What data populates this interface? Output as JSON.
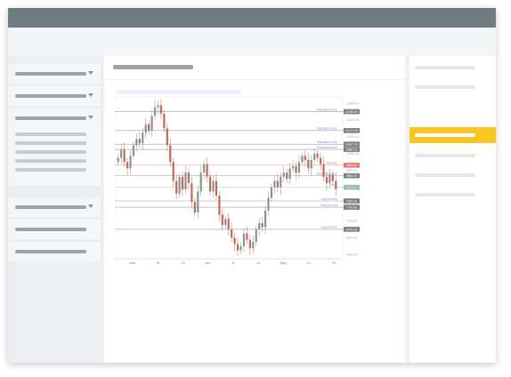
{
  "app": {
    "accent_color": "#f7c620",
    "titlebar_color": "#6e7c82"
  },
  "chart_data": {
    "type": "candlestick",
    "x_ticks": [
      "Mar",
      "15",
      "22",
      "Apr",
      "5",
      "12",
      "May",
      "10",
      "22"
    ],
    "y_ticks": [
      "13000.00",
      "12200.00",
      "11400.00",
      "10600.00",
      "9800.00",
      "9000.00",
      "8200.00",
      "7400.00",
      "6600.00",
      "5800.00"
    ],
    "series": [
      {
        "values": [
          10400,
          10800,
          10200,
          9900,
          10500,
          11000,
          11300,
          11100,
          11600,
          12000,
          11700,
          12400,
          12800,
          12900,
          12500,
          11800,
          11000,
          10200,
          9300,
          8700,
          9500,
          8900,
          9700,
          9200,
          8300,
          7800,
          8800,
          9700,
          10100,
          9500,
          8800,
          9300,
          8600,
          7700,
          7200,
          7500,
          7000,
          6600,
          6300,
          6000,
          6200,
          6800,
          6500,
          6100,
          6400,
          7000,
          7300,
          7100,
          7900,
          8500,
          9000,
          9300,
          9000,
          9500,
          9700,
          9400,
          9900,
          10000,
          9700,
          10200,
          10500,
          10300,
          9900,
          10300,
          10600,
          10400,
          10100,
          9500,
          9200,
          9600,
          9300,
          8900
        ]
      }
    ],
    "levels": [
      {
        "label": "Resistance level",
        "value": "11950.00",
        "value_num": 12600,
        "tag_color": "#7a7f85"
      },
      {
        "label": "Resistance level",
        "value": "11717.00",
        "value_num": 11700,
        "tag_color": "#7a7f85"
      },
      {
        "label": "Resistance level",
        "value": "10817.00",
        "value_num": 11050,
        "tag_color": "#7a7f85"
      },
      {
        "label": "Resistance level",
        "value": "9880.73",
        "value_num": 10800,
        "tag_color": "#7a7f85"
      },
      {
        "label": "Trend line",
        "value": "9818.00",
        "value_num": 10050,
        "tag_color": "#e07a7a"
      },
      {
        "label": "Resistance level",
        "value": "8860.00",
        "value_num": 9550,
        "tag_color": "#7a7f85"
      },
      {
        "label": "Price",
        "value": "8596.00",
        "value_num": 9000,
        "tag_color": "#9fbfa3"
      },
      {
        "label": "Support level",
        "value": "7987.00",
        "value_num": 8350,
        "tag_color": "#7a7f85"
      },
      {
        "label": "Support level",
        "value": "7700.00",
        "value_num": 8050,
        "tag_color": "#7a7f85"
      },
      {
        "label": "Support level",
        "value": "6700.00",
        "value_num": 7000,
        "tag_color": "#7a7f85"
      }
    ],
    "ylim": [
      5600,
      13300
    ]
  }
}
